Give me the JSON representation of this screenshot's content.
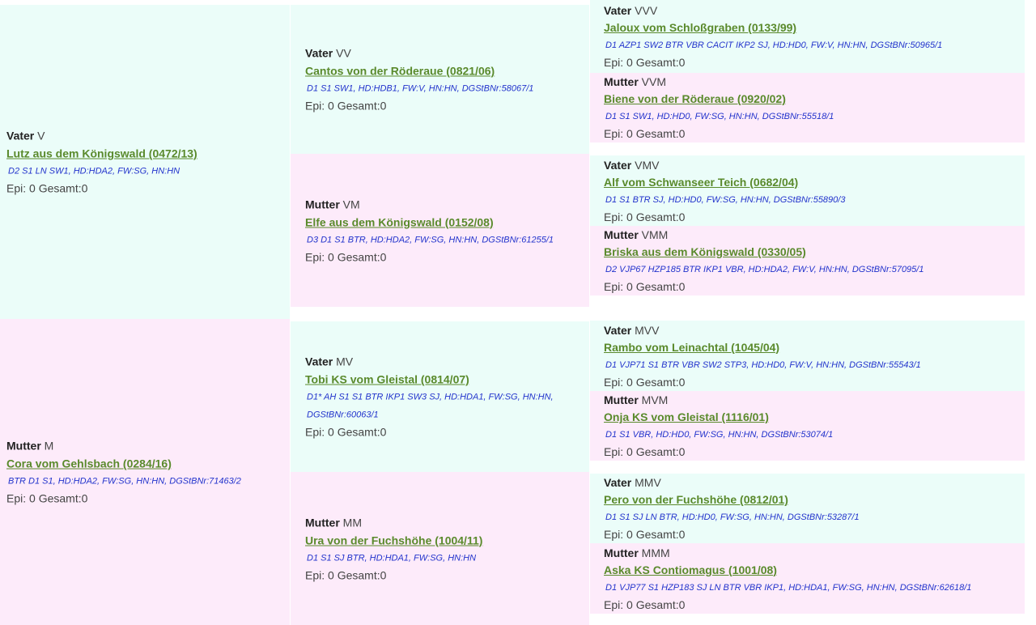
{
  "labels": {
    "vater": "Vater",
    "mutter": "Mutter"
  },
  "colors": {
    "vater_bg": "#ebfdf9",
    "mutter_bg": "#fdebfa",
    "name_link": "#5a8a2c",
    "titles": "#2233cc"
  },
  "ancestors": [
    {
      "code": "V",
      "name": "Lutz aus dem Königswald (0472/13)",
      "titles": "D2 S1 LN SW1, HD:HDA2, FW:SG, HN:HN",
      "epi": "Epi: 0 Gesamt:0"
    },
    {
      "code": "VV",
      "name": "Cantos von der Röderaue (0821/06)",
      "titles": "D1 S1 SW1, HD:HDB1, FW:V, HN:HN, DGStBNr:58067/1",
      "epi": "Epi: 0 Gesamt:0"
    },
    {
      "code": "VVV",
      "name": "Jaloux vom Schloßgraben (0133/99)",
      "titles": "D1 AZP1 SW2 BTR VBR CACIT IKP2 SJ, HD:HD0, FW:V, HN:HN, DGStBNr:50965/1",
      "epi": "Epi: 0 Gesamt:0"
    },
    {
      "code": "VVM",
      "name": "Biene von der Röderaue (0920/02)",
      "titles": "D1 S1 SW1, HD:HD0, FW:SG, HN:HN, DGStBNr:55518/1",
      "epi": "Epi: 0 Gesamt:0"
    },
    {
      "code": "VM",
      "name": "Elfe aus dem Königswald (0152/08)",
      "titles": "D3 D1 S1 BTR, HD:HDA2, FW:SG, HN:HN, DGStBNr:61255/1",
      "epi": "Epi: 0 Gesamt:0"
    },
    {
      "code": "VMV",
      "name": "Alf vom Schwanseer Teich (0682/04)",
      "titles": "D1 S1 BTR SJ, HD:HD0, FW:SG, HN:HN, DGStBNr:55890/3",
      "epi": "Epi: 0 Gesamt:0"
    },
    {
      "code": "VMM",
      "name": "Briska aus dem Königswald (0330/05)",
      "titles": "D2 VJP67 HZP185 BTR IKP1 VBR, HD:HDA2, FW:V, HN:HN, DGStBNr:57095/1",
      "epi": "Epi: 0 Gesamt:0"
    },
    {
      "code": "M",
      "name": "Cora vom Gehlsbach (0284/16)",
      "titles": "BTR D1 S1, HD:HDA2, FW:SG, HN:HN, DGStBNr:71463/2",
      "epi": "Epi: 0 Gesamt:0"
    },
    {
      "code": "MV",
      "name": "Tobi KS vom Gleistal (0814/07)",
      "titles": "D1* AH S1 S1 BTR IKP1 SW3 SJ, HD:HDA1, FW:SG, HN:HN, DGStBNr:60063/1",
      "epi": "Epi: 0 Gesamt:0"
    },
    {
      "code": "MVV",
      "name": "Rambo vom Leinachtal (1045/04)",
      "titles": "D1 VJP71 S1 BTR VBR SW2 STP3, HD:HD0, FW:V, HN:HN, DGStBNr:55543/1",
      "epi": "Epi: 0 Gesamt:0"
    },
    {
      "code": "MVM",
      "name": "Onja KS vom Gleistal (1116/01)",
      "titles": "D1 S1 VBR, HD:HD0, FW:SG, HN:HN, DGStBNr:53074/1",
      "epi": "Epi: 0 Gesamt:0"
    },
    {
      "code": "MM",
      "name": "Ura von der Fuchshöhe (1004/11)",
      "titles": "D1 S1 SJ BTR, HD:HDA1, FW:SG, HN:HN",
      "epi": "Epi: 0 Gesamt:0"
    },
    {
      "code": "MMV",
      "name": "Pero von der Fuchshöhe (0812/01)",
      "titles": "D1 S1 SJ LN BTR, HD:HD0, FW:SG, HN:HN, DGStBNr:53287/1",
      "epi": "Epi: 0 Gesamt:0"
    },
    {
      "code": "MMM",
      "name": "Aska KS Contiomagus (1001/08)",
      "titles": "D1 VJP77 S1 HZP183 SJ LN BTR VBR IKP1, HD:HDA1, FW:SG, HN:HN, DGStBNr:62618/1",
      "epi": "Epi: 0 Gesamt:0"
    }
  ]
}
